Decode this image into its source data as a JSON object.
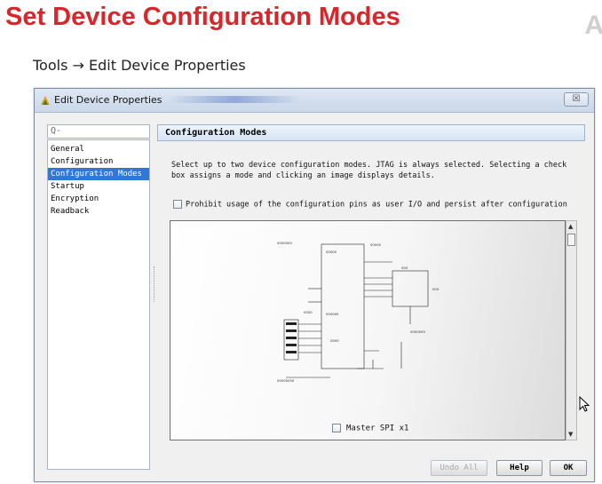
{
  "slide": {
    "title": "Set Device Configuration Modes",
    "corner_logo": "A",
    "nav_path": "Tools → Edit Device Properties"
  },
  "window": {
    "title": "Edit Device Properties",
    "close_glyph": "☒"
  },
  "sidebar": {
    "search_placeholder": "Q-",
    "items": [
      {
        "label": "General"
      },
      {
        "label": "Configuration"
      },
      {
        "label": "Configuration Modes",
        "selected": true
      },
      {
        "label": "Startup"
      },
      {
        "label": "Encryption"
      },
      {
        "label": "Readback"
      }
    ]
  },
  "panel": {
    "header": "Configuration Modes",
    "description": "Select up to two device configuration modes. JTAG is always selected. Selecting a check box assigns a mode and clicking an image displays details.",
    "prohibit_label": "Prohibit usage of the configuration pins as user I/O and persist after configuration",
    "prohibit_checked": false,
    "mode_label": "Master SPI x1",
    "mode_checked": false
  },
  "buttons": {
    "undo_all": "Undo All",
    "help": "Help",
    "ok": "OK"
  },
  "colors": {
    "title_red": "#d9262a",
    "selection_blue": "#3377d6",
    "header_bg": "#d7e4f3"
  },
  "icons": {
    "app": "app-logo-icon",
    "cursor": "mouse-cursor-icon"
  }
}
